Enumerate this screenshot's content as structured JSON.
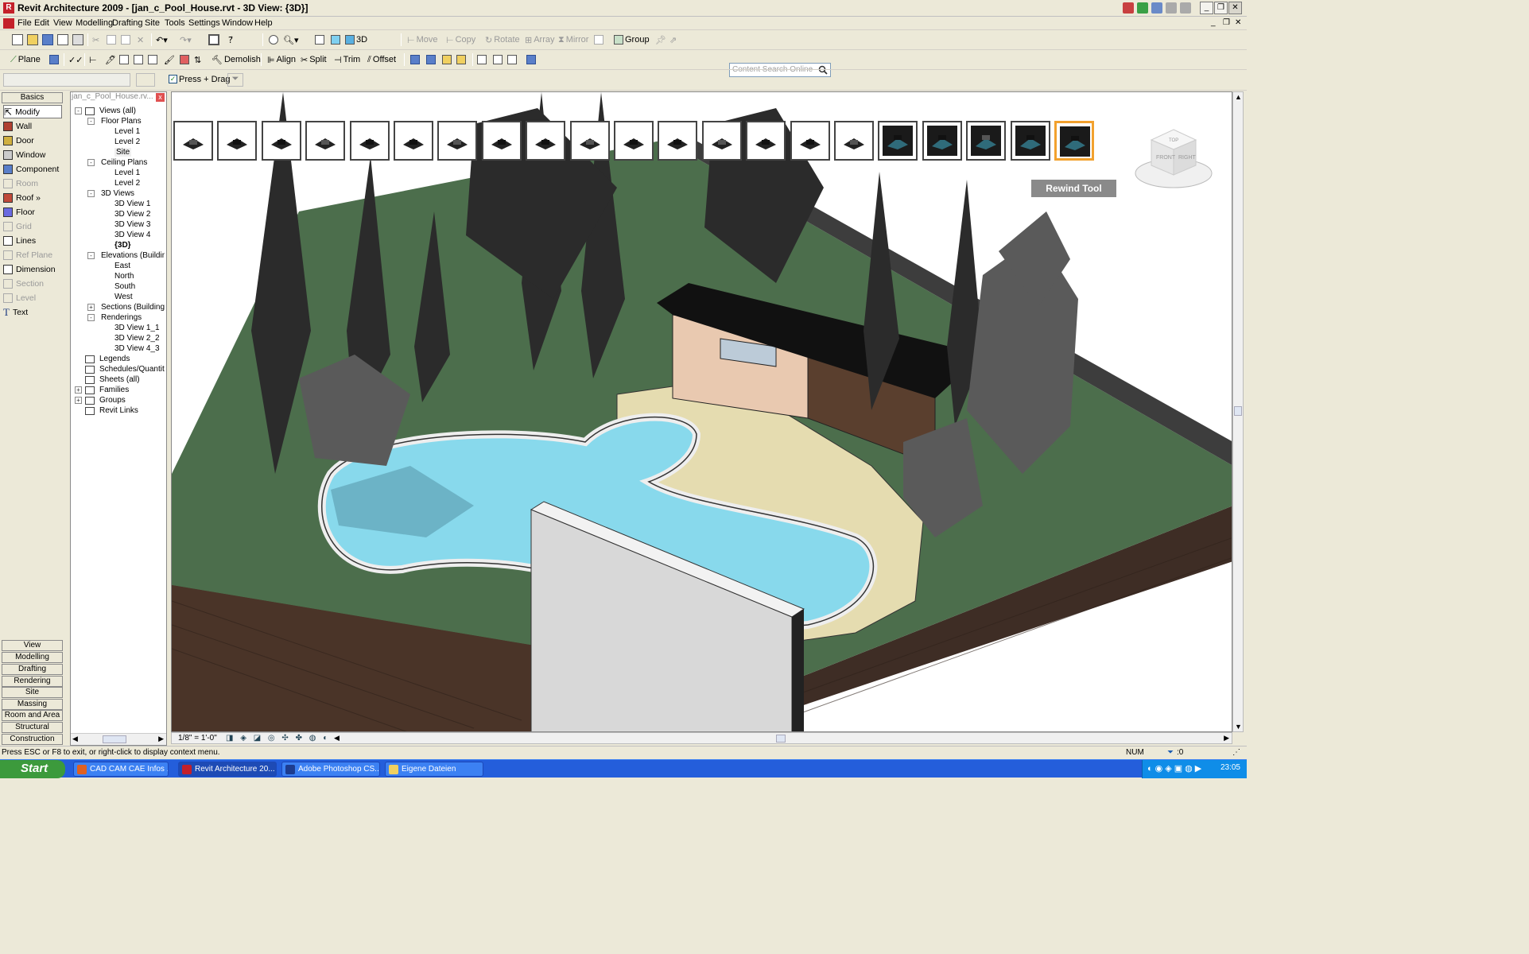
{
  "window": {
    "title": "Revit Architecture 2009 - [jan_c_Pool_House.rvt - 3D View: {3D}]",
    "app_icon": "revit-r-icon"
  },
  "menu": [
    "File",
    "Edit",
    "View",
    "Modelling",
    "Drafting",
    "Site",
    "Tools",
    "Settings",
    "Window",
    "Help"
  ],
  "toolbar1": {
    "view3d_label": "3D",
    "move": "Move",
    "copy": "Copy",
    "rotate": "Rotate",
    "array": "Array",
    "mirror": "Mirror",
    "group": "Group",
    "search_placeholder": "Content Search Online"
  },
  "toolbar2": {
    "plane": "Plane",
    "demolish": "Demolish",
    "align": "Align",
    "split": "Split",
    "trim": "Trim",
    "offset": "Offset"
  },
  "options_bar": {
    "press_drag": "Press + Drag"
  },
  "palette": {
    "tab": "Basics",
    "items": [
      "Modify",
      "Wall",
      "Door",
      "Window",
      "Component",
      "Room",
      "Roof »",
      "Floor",
      "Grid",
      "Lines",
      "Ref Plane",
      "Dimension",
      "Section",
      "Level",
      "Text"
    ],
    "bottom_tabs": [
      "View",
      "Modelling",
      "Drafting",
      "Rendering",
      "Site",
      "Massing",
      "Room and Area",
      "Structural",
      "Construction"
    ]
  },
  "browser": {
    "title": "jan_c_Pool_House.rv...",
    "nodes": [
      {
        "label": "Views (all)",
        "level": 0
      },
      {
        "label": "Floor Plans",
        "level": 1
      },
      {
        "label": "Level 1",
        "level": 2
      },
      {
        "label": "Level 2",
        "level": 2
      },
      {
        "label": "Site",
        "level": 2
      },
      {
        "label": "Ceiling Plans",
        "level": 1
      },
      {
        "label": "Level 1",
        "level": 2
      },
      {
        "label": "Level 2",
        "level": 2
      },
      {
        "label": "3D Views",
        "level": 1
      },
      {
        "label": "3D View 1",
        "level": 2
      },
      {
        "label": "3D View 2",
        "level": 2
      },
      {
        "label": "3D View 3",
        "level": 2
      },
      {
        "label": "3D View 4",
        "level": 2
      },
      {
        "label": "{3D}",
        "level": 2
      },
      {
        "label": "Elevations (Building",
        "level": 1
      },
      {
        "label": "East",
        "level": 2
      },
      {
        "label": "North",
        "level": 2
      },
      {
        "label": "South",
        "level": 2
      },
      {
        "label": "West",
        "level": 2
      },
      {
        "label": "Sections (Building S",
        "level": 1
      },
      {
        "label": "Renderings",
        "level": 1
      },
      {
        "label": "3D View 1_1",
        "level": 2
      },
      {
        "label": "3D View 2_2",
        "level": 2
      },
      {
        "label": "3D View 4_3",
        "level": 2
      },
      {
        "label": "Legends",
        "level": 0
      },
      {
        "label": "Schedules/Quantitie",
        "level": 0
      },
      {
        "label": "Sheets (all)",
        "level": 0
      },
      {
        "label": "Families",
        "level": 0
      },
      {
        "label": "Groups",
        "level": 0
      },
      {
        "label": "Revit Links",
        "level": 0
      }
    ]
  },
  "viewport": {
    "rewind_tool": "Rewind Tool",
    "viewcube_faces": [
      "TOP",
      "FRONT",
      "RIGHT"
    ],
    "scale": "1/8\" = 1'-0\"",
    "thumbnail_count": 21
  },
  "status": {
    "message": "Press ESC or F8 to exit, or right-click to display context menu.",
    "num": "NUM",
    "filter": ":0"
  },
  "taskbar": {
    "start": "Start",
    "tasks": [
      "CAD CAM CAE Infos ...",
      "Revit Architecture 20...",
      "Adobe Photoshop CS...",
      "Eigene Dateien"
    ],
    "clock": "23:05"
  },
  "colors": {
    "pool_water": "#88d9ec",
    "lawn": "#4c6e4c",
    "soil": "#4a3428",
    "paving": "#e5dcb0",
    "roof": "#111111",
    "selection": "#f2a12e"
  }
}
